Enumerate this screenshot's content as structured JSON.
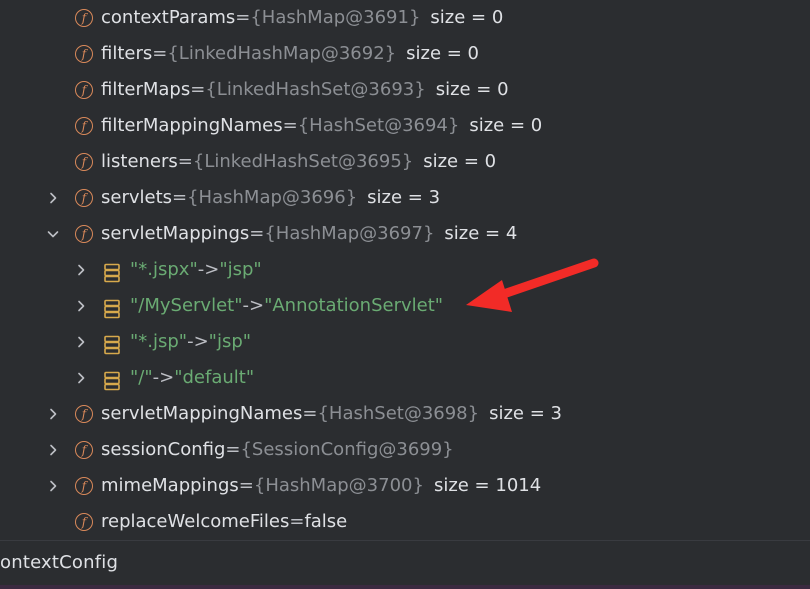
{
  "rows": [
    {
      "name": "contextParams",
      "op": " = ",
      "ref": "{HashMap@3691}",
      "size": "size = 0",
      "expander": "none"
    },
    {
      "name": "filters",
      "op": " = ",
      "ref": "{LinkedHashMap@3692}",
      "size": "size = 0",
      "expander": "none"
    },
    {
      "name": "filterMaps",
      "op": " = ",
      "ref": "{LinkedHashSet@3693}",
      "size": "size = 0",
      "expander": "none"
    },
    {
      "name": "filterMappingNames",
      "op": " = ",
      "ref": "{HashSet@3694}",
      "size": "size = 0",
      "expander": "none"
    },
    {
      "name": "listeners",
      "op": " = ",
      "ref": "{LinkedHashSet@3695}",
      "size": "size = 0",
      "expander": "none"
    },
    {
      "name": "servlets",
      "op": " = ",
      "ref": "{HashMap@3696}",
      "size": "size = 3",
      "expander": "chevron-right"
    },
    {
      "name": "servletMappings",
      "op": " = ",
      "ref": "{HashMap@3697}",
      "size": "size = 4",
      "expander": "chevron-down"
    },
    {
      "entry": [
        "\"*.jspx\"",
        " -> ",
        "\"jsp\""
      ],
      "expander": "chevron-right"
    },
    {
      "entry": [
        "\"/MyServlet\"",
        " -> ",
        "\"AnnotationServlet\""
      ],
      "expander": "chevron-right"
    },
    {
      "entry": [
        "\"*.jsp\"",
        " -> ",
        "\"jsp\""
      ],
      "expander": "chevron-right"
    },
    {
      "entry": [
        "\"/\"",
        " -> ",
        "\"default\""
      ],
      "expander": "chevron-right"
    },
    {
      "name": "servletMappingNames",
      "op": " = ",
      "ref": "{HashSet@3698}",
      "size": "size = 3",
      "expander": "chevron-right"
    },
    {
      "name": "sessionConfig",
      "op": " = ",
      "ref": "{SessionConfig@3699}",
      "size": "",
      "expander": "chevron-right"
    },
    {
      "name": "mimeMappings",
      "op": " = ",
      "ref": "{HashMap@3700}",
      "size": "size = 1014",
      "expander": "chevron-right"
    },
    {
      "name": "replaceWelcomeFiles",
      "op": " = ",
      "ref": "",
      "size": "false",
      "expander": "none"
    }
  ],
  "field_icon_glyph": "f",
  "icons": {
    "field": "field-f-icon",
    "entry": "map-entry-icon",
    "expand": "chevron-right-icon",
    "collapse": "chevron-down-icon",
    "annotation": "red-arrow-annotation"
  },
  "bottom_bar": {
    "label": "ontextConfig"
  },
  "colors": {
    "background": "#2b2d30",
    "text": "#dfe1e5",
    "reference": "#8c8f94",
    "string": "#6aab73",
    "field_icon": "#d9895a",
    "entry_icon": "#d7a94c",
    "arrow": "#f22b27"
  }
}
